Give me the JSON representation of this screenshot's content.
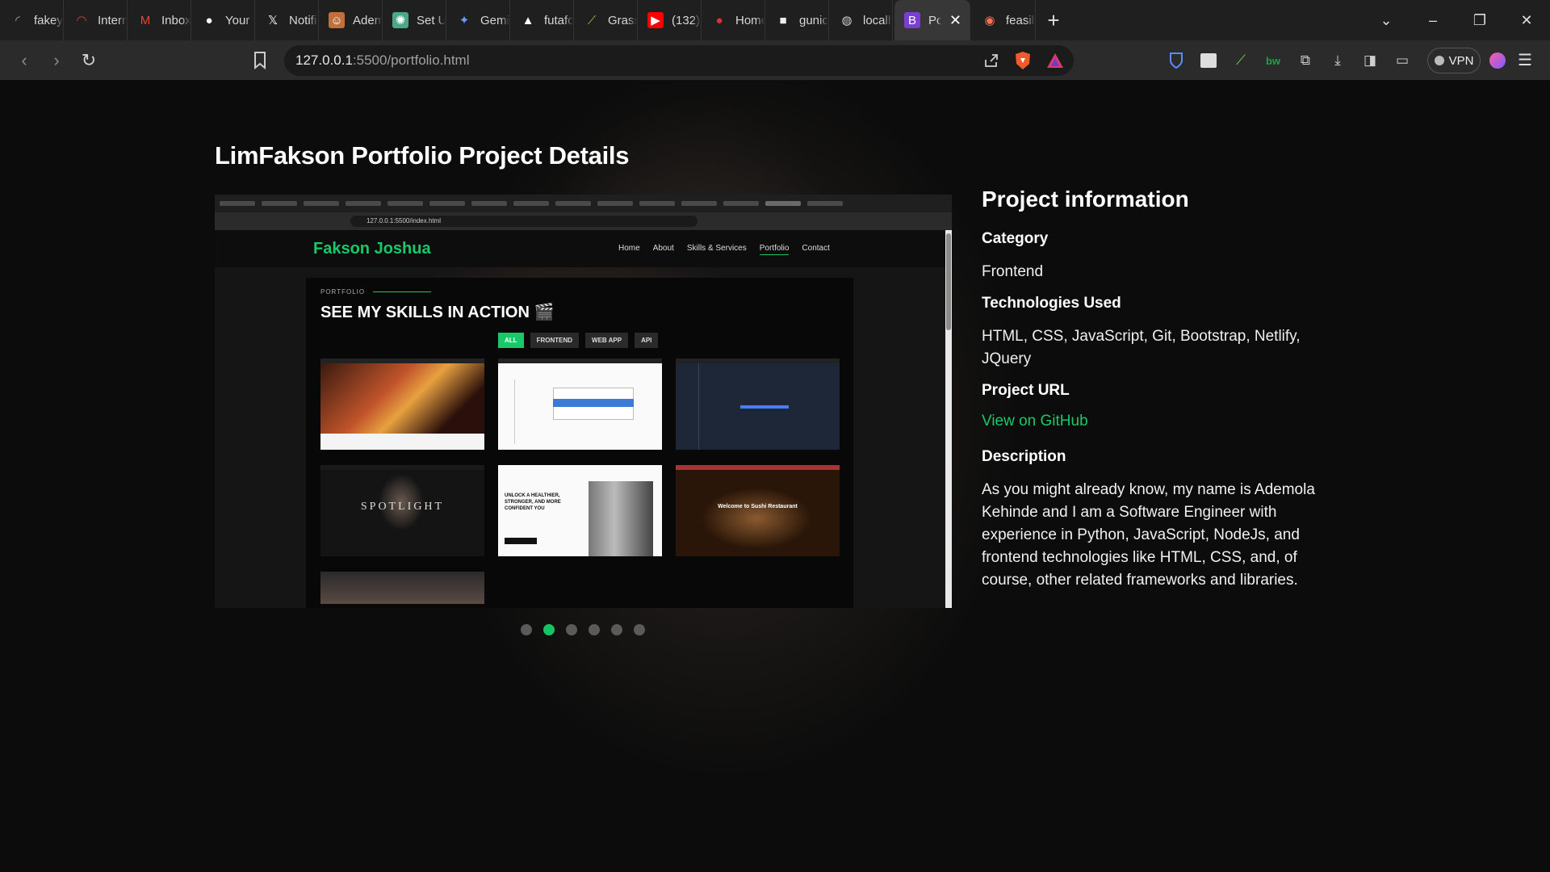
{
  "browser": {
    "tabs": [
      {
        "label": "fakeye",
        "icon": "loading-spinner-icon"
      },
      {
        "label": "Internet",
        "icon": "speedometer-icon"
      },
      {
        "label": "Inbox",
        "icon": "gmail-icon"
      },
      {
        "label": "Your R",
        "icon": "github-icon"
      },
      {
        "label": "Notific",
        "icon": "x-icon"
      },
      {
        "label": "Adem",
        "icon": "avatar-icon"
      },
      {
        "label": "Set Us",
        "icon": "openai-icon"
      },
      {
        "label": "Gemin",
        "icon": "gemini-sparkle-icon"
      },
      {
        "label": "futafor",
        "icon": "triangle-logo-icon"
      },
      {
        "label": "Grass",
        "icon": "grass-chart-icon"
      },
      {
        "label": "(132)",
        "icon": "youtube-icon"
      },
      {
        "label": "Home",
        "icon": "pin-icon"
      },
      {
        "label": "gunicc",
        "icon": "box-icon"
      },
      {
        "label": "localh",
        "icon": "globe-icon"
      },
      {
        "label": "Pc",
        "icon": "bootstrap-icon",
        "active": true
      },
      {
        "label": "feasibl",
        "icon": "brave-icon"
      }
    ],
    "url_host": "127.0.0.1",
    "url_path": ":5500/portfolio.html",
    "vpn_label": "VPN"
  },
  "page": {
    "title": "LimFakson Portfolio Project Details"
  },
  "screenshot": {
    "url": "127.0.0.1:5500/index.html",
    "brand": "Fakson Joshua",
    "nav": [
      "Home",
      "About",
      "Skills & Services",
      "Portfolio",
      "Contact"
    ],
    "kicker": "PORTFOLIO",
    "heading": "SEE MY SKILLS IN ACTION 🎬",
    "filters": [
      "ALL",
      "FRONTEND",
      "WEB APP",
      "API"
    ],
    "spotlight": "SPOTLIGHT",
    "gym_text": "UNLOCK A HEALTHIER, STRONGER, AND MORE CONFIDENT YOU",
    "sushi_text": "Welcome to Sushi Restaurant"
  },
  "carousel": {
    "slide_count": 6,
    "active_index": 1
  },
  "project": {
    "heading": "Project information",
    "category_label": "Category",
    "category_value": "Frontend",
    "tech_label": "Technologies Used",
    "tech_value": "HTML, CSS, JavaScript, Git, Bootstrap, Netlify, JQuery",
    "url_label": "Project URL",
    "url_link_text": "View on GitHub",
    "desc_label": "Description",
    "desc_text": "As you might already know, my name is Ademola Kehinde and I am a Software Engineer with experience in Python, JavaScript, NodeJs, and frontend technologies like HTML, CSS, and, of course, other related frameworks and libraries."
  },
  "colors": {
    "accent": "#19c868",
    "background": "#0c0c0c"
  }
}
